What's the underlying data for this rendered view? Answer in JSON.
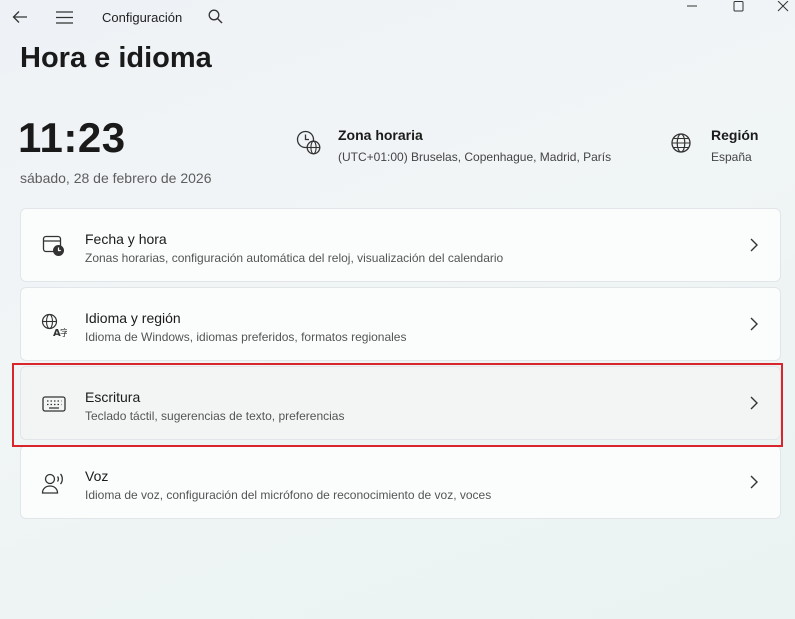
{
  "window": {
    "app_title": "Configuración",
    "back_icon": "arrow-left-icon",
    "menu_icon": "hamburger-icon",
    "search_icon": "search-icon"
  },
  "page": {
    "title": "Hora e idioma"
  },
  "summary": {
    "time": "11:23",
    "date": "sábado, 28 de febrero de 2026",
    "timezone": {
      "label": "Zona horaria",
      "value": "(UTC+01:00) Bruselas, Copenhague, Madrid, París",
      "icon": "clock-globe-icon"
    },
    "region": {
      "label": "Región",
      "value": "España",
      "icon": "globe-icon"
    }
  },
  "cards": [
    {
      "title": "Fecha y hora",
      "subtitle": "Zonas horarias, configuración automática del reloj, visualización del calendario",
      "icon": "calendar-clock-icon"
    },
    {
      "title": "Idioma y región",
      "subtitle": "Idioma de Windows, idiomas preferidos, formatos regionales",
      "icon": "language-icon"
    },
    {
      "title": "Escritura",
      "subtitle": "Teclado táctil, sugerencias de texto, preferencias",
      "icon": "keyboard-icon"
    },
    {
      "title": "Voz",
      "subtitle": "Idioma de voz, configuración del micrófono de reconocimiento de voz, voces",
      "icon": "speech-icon"
    }
  ],
  "colors": {
    "highlight": "#d9262c",
    "card_background": "#fbfcfc"
  }
}
